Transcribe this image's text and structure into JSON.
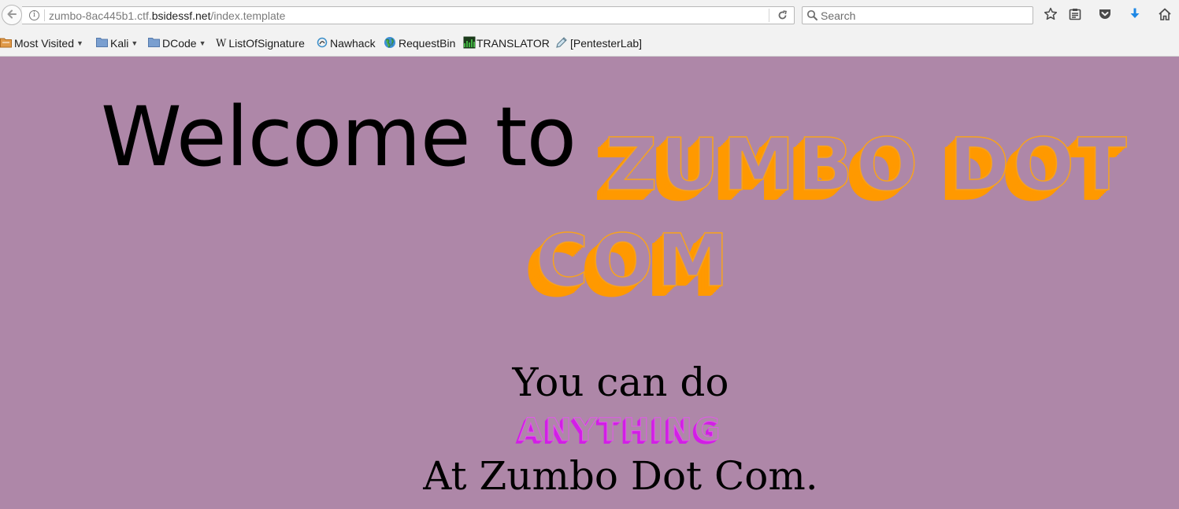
{
  "browser": {
    "url": {
      "prefix": "zumbo-8ac445b1.ctf.",
      "host": "bsidessf.net",
      "path": "/index.template"
    },
    "search_placeholder": "Search",
    "bookmarks": [
      {
        "label": "Most Visited",
        "icon": "folder-icon",
        "has_dropdown": true
      },
      {
        "label": "Kali",
        "icon": "folder-icon",
        "has_dropdown": true
      },
      {
        "label": "DCode",
        "icon": "folder-icon",
        "has_dropdown": true
      },
      {
        "label": "ListOfSignature",
        "icon": "wikipedia-icon",
        "has_dropdown": false
      },
      {
        "label": "Nawhack",
        "icon": "nawhack-icon",
        "has_dropdown": false
      },
      {
        "label": "RequestBin",
        "icon": "globe-icon",
        "has_dropdown": false
      },
      {
        "label": "TRANSLATOR",
        "icon": "translator-icon",
        "has_dropdown": false
      },
      {
        "label": "[PentesterLab]",
        "icon": "pen-icon",
        "has_dropdown": false
      }
    ],
    "dropdown_glyph": "▼"
  },
  "page": {
    "welcome": "Welcome to",
    "brand_line_1": "ZUMBO DOT",
    "brand_line_2": "COM",
    "tagline_1": "You can do",
    "anything": "ANYTHING",
    "tagline_2": "At Zumbo Dot Com.",
    "colors": {
      "background": "#ae87a8",
      "brand_orange": "#ff9900",
      "anything_magenta": "#d21fe6"
    }
  }
}
